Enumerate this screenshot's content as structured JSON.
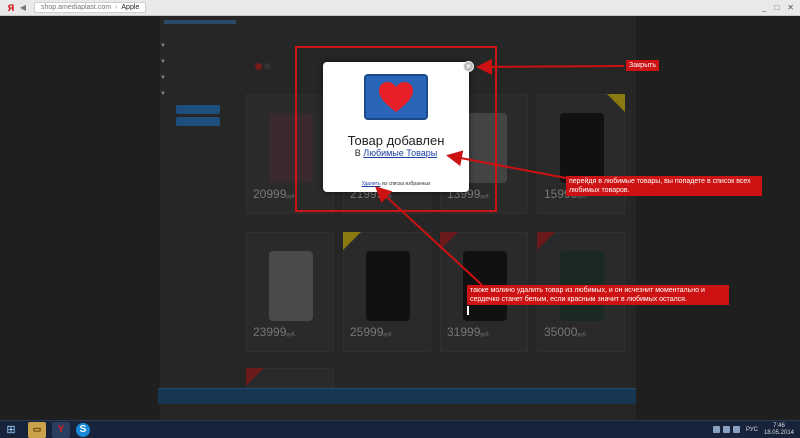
{
  "browser": {
    "logo": "Я",
    "url": "shop.amediaplast.com",
    "separator": "›",
    "tab_title": "Apple",
    "window_controls": [
      "_",
      "□",
      "✕"
    ]
  },
  "products": [
    {
      "price": "20999",
      "currency": "руб."
    },
    {
      "price": "21999",
      "currency": "руб."
    },
    {
      "price": "13999",
      "currency": "руб."
    },
    {
      "price": "15999",
      "currency": "руб."
    },
    {
      "price": "23999",
      "currency": "руб."
    },
    {
      "price": "25999",
      "currency": "руб."
    },
    {
      "price": "31999",
      "currency": "руб."
    },
    {
      "price": "35000",
      "currency": "руб."
    }
  ],
  "modal": {
    "title": "Товар добавлен",
    "subtitle_prefix": "В",
    "favorites_link": "Любимые Товары",
    "remove_link": "Удалить",
    "remove_suffix": "из списка избранных",
    "close_symbol": "×",
    "icon": "heart-icon",
    "heart_color": "#e8202a",
    "box_color": "#2a66b8"
  },
  "annotations": {
    "close_note": "Закрыть",
    "favorites_note": "перейдя в любимые товары, вы попадете в список всех любимых товаров.",
    "remove_note": "также молино удалить товар из любимых, и он исчезнит моментально и сердечко станет белым, если красным значит в любимых остался.",
    "color": "#cc1212"
  },
  "taskbar": {
    "start_icon": "windows-icon",
    "folder_label": "▭",
    "yandex_label": "Y",
    "skype_label": "S",
    "lang": "РУС",
    "time": "7:46",
    "date": "18.05.2014"
  }
}
